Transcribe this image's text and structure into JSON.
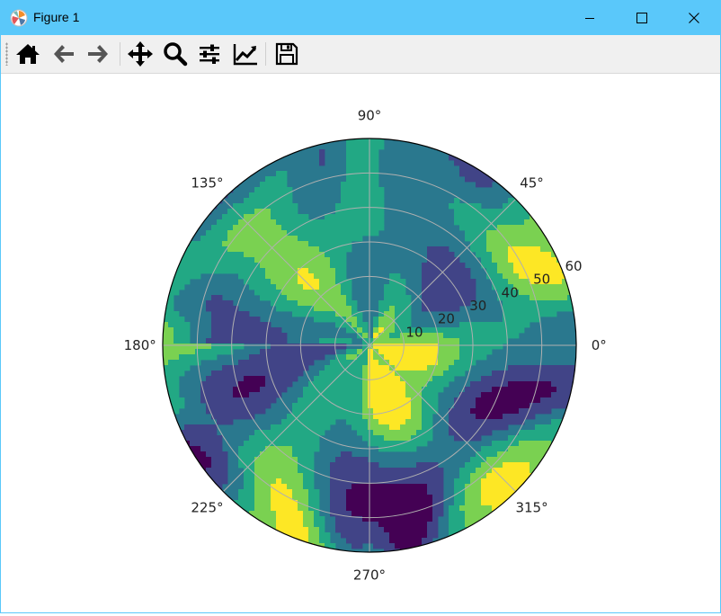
{
  "window": {
    "title": "Figure 1"
  },
  "toolbar": {
    "buttons": [
      {
        "name": "home-icon"
      },
      {
        "name": "back-arrow-icon"
      },
      {
        "name": "forward-arrow-icon"
      },
      {
        "name": "pan-icon"
      },
      {
        "name": "zoom-icon"
      },
      {
        "name": "subplots-config-icon"
      },
      {
        "name": "edit-axis-icon"
      },
      {
        "name": "save-icon"
      }
    ]
  },
  "colors": {
    "titlebar": "#5ac8fa",
    "viridis": [
      "#440154",
      "#414487",
      "#2a788e",
      "#22a884",
      "#7ad151",
      "#fde725"
    ],
    "grid": "#b0b0b0"
  },
  "chart_data": {
    "type": "polar-contourf",
    "colormap": "viridis",
    "theta_labels": [
      {
        "deg": 0,
        "label": "0°"
      },
      {
        "deg": 45,
        "label": "45°"
      },
      {
        "deg": 90,
        "label": "90°"
      },
      {
        "deg": 135,
        "label": "135°"
      },
      {
        "deg": 180,
        "label": "180°"
      },
      {
        "deg": 225,
        "label": "225°"
      },
      {
        "deg": 270,
        "label": "270°"
      },
      {
        "deg": 315,
        "label": "315°"
      }
    ],
    "r_ticks": [
      {
        "r": 10,
        "label": "10"
      },
      {
        "r": 20,
        "label": "20"
      },
      {
        "r": 30,
        "label": "30"
      },
      {
        "r": 40,
        "label": "40"
      },
      {
        "r": 50,
        "label": "50"
      },
      {
        "r": 60,
        "label": "60"
      }
    ],
    "rlim": [
      0,
      60
    ],
    "r_label_angle_deg": 22.5,
    "grid": true
  }
}
